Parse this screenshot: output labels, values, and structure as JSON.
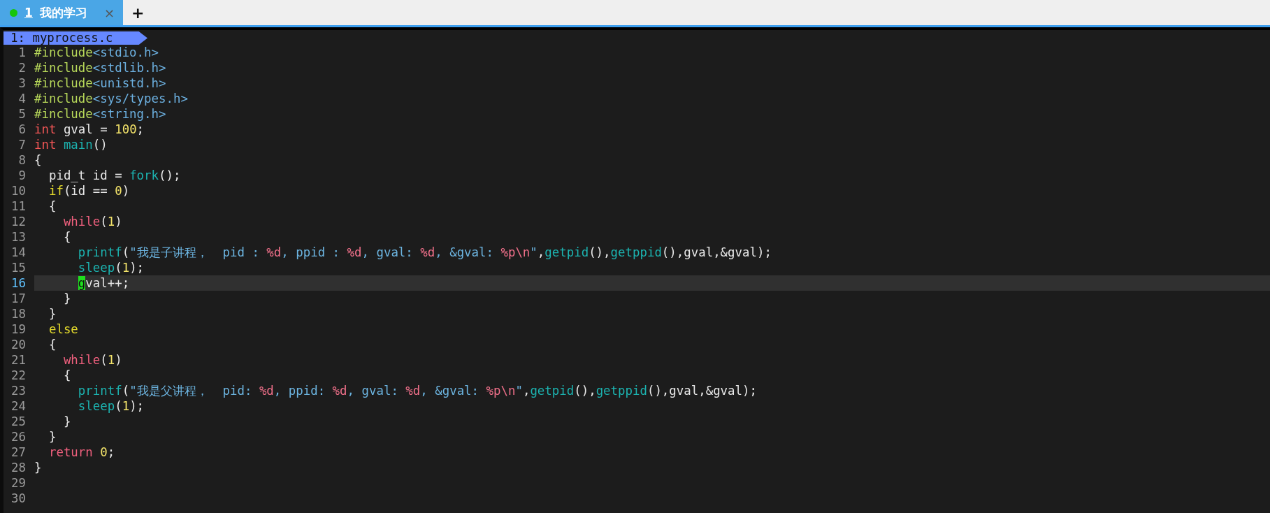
{
  "tabs": [
    {
      "number": "1",
      "title": "我的学习",
      "selected": true,
      "close": "×"
    }
  ],
  "new_tab": "+",
  "buffer_label": "1: myprocess.c",
  "lines": [
    {
      "number": "1",
      "current": false,
      "tokens": [
        {
          "kind": "preproc",
          "text": "#include"
        },
        {
          "kind": "header",
          "text": "<stdio.h>"
        }
      ]
    },
    {
      "number": "2",
      "current": false,
      "tokens": [
        {
          "kind": "preproc",
          "text": "#include"
        },
        {
          "kind": "header",
          "text": "<stdlib.h>"
        }
      ]
    },
    {
      "number": "3",
      "current": false,
      "tokens": [
        {
          "kind": "preproc",
          "text": "#include"
        },
        {
          "kind": "header",
          "text": "<unistd.h>"
        }
      ]
    },
    {
      "number": "4",
      "current": false,
      "tokens": [
        {
          "kind": "preproc",
          "text": "#include"
        },
        {
          "kind": "header",
          "text": "<sys/types.h>"
        }
      ]
    },
    {
      "number": "5",
      "current": false,
      "tokens": [
        {
          "kind": "preproc",
          "text": "#include"
        },
        {
          "kind": "header",
          "text": "<string.h>"
        }
      ]
    },
    {
      "number": "6",
      "current": false,
      "tokens": [
        {
          "kind": "type",
          "text": "int"
        },
        {
          "kind": "plain",
          "text": " gval = "
        },
        {
          "kind": "number",
          "text": "100"
        },
        {
          "kind": "plain",
          "text": ";"
        }
      ]
    },
    {
      "number": "7",
      "current": false,
      "tokens": [
        {
          "kind": "type",
          "text": "int"
        },
        {
          "kind": "func",
          "text": " main"
        },
        {
          "kind": "plain",
          "text": "()"
        }
      ]
    },
    {
      "number": "8",
      "current": false,
      "tokens": [
        {
          "kind": "plain",
          "text": "{"
        }
      ]
    },
    {
      "number": "9",
      "current": false,
      "tokens": [
        {
          "kind": "plain",
          "text": "  pid_t id = "
        },
        {
          "kind": "func",
          "text": "fork"
        },
        {
          "kind": "plain",
          "text": "();"
        }
      ]
    },
    {
      "number": "10",
      "current": false,
      "tokens": [
        {
          "kind": "cond",
          "text": "  if"
        },
        {
          "kind": "plain",
          "text": "(id == "
        },
        {
          "kind": "number",
          "text": "0"
        },
        {
          "kind": "plain",
          "text": ")"
        }
      ]
    },
    {
      "number": "11",
      "current": false,
      "tokens": [
        {
          "kind": "plain",
          "text": "  {"
        }
      ]
    },
    {
      "number": "12",
      "current": false,
      "tokens": [
        {
          "kind": "keyword",
          "text": "    while"
        },
        {
          "kind": "plain",
          "text": "("
        },
        {
          "kind": "number",
          "text": "1"
        },
        {
          "kind": "plain",
          "text": ")"
        }
      ]
    },
    {
      "number": "13",
      "current": false,
      "tokens": [
        {
          "kind": "plain",
          "text": "    {"
        }
      ]
    },
    {
      "number": "14",
      "current": false,
      "tokens": [
        {
          "kind": "func",
          "text": "      printf"
        },
        {
          "kind": "plain",
          "text": "("
        },
        {
          "kind": "string",
          "text": "\"我是子讲程，  pid : "
        },
        {
          "kind": "format",
          "text": "%d"
        },
        {
          "kind": "string",
          "text": ", ppid : "
        },
        {
          "kind": "format",
          "text": "%d"
        },
        {
          "kind": "string",
          "text": ", gval: "
        },
        {
          "kind": "format",
          "text": "%d"
        },
        {
          "kind": "string",
          "text": ", &gval: "
        },
        {
          "kind": "format",
          "text": "%p\\n"
        },
        {
          "kind": "string",
          "text": "\""
        },
        {
          "kind": "plain",
          "text": ","
        },
        {
          "kind": "func",
          "text": "getpid"
        },
        {
          "kind": "plain",
          "text": "(),"
        },
        {
          "kind": "func",
          "text": "getppid"
        },
        {
          "kind": "plain",
          "text": "(),gval,&gval);"
        }
      ]
    },
    {
      "number": "15",
      "current": false,
      "tokens": [
        {
          "kind": "func",
          "text": "      sleep"
        },
        {
          "kind": "plain",
          "text": "("
        },
        {
          "kind": "number",
          "text": "1"
        },
        {
          "kind": "plain",
          "text": ");"
        }
      ]
    },
    {
      "number": "16",
      "current": true,
      "tokens": [
        {
          "kind": "cursor",
          "text": "      g"
        },
        {
          "kind": "plain",
          "text": "val++;"
        }
      ]
    },
    {
      "number": "17",
      "current": false,
      "tokens": [
        {
          "kind": "plain",
          "text": "    }"
        }
      ]
    },
    {
      "number": "18",
      "current": false,
      "tokens": [
        {
          "kind": "plain",
          "text": "  }"
        }
      ]
    },
    {
      "number": "19",
      "current": false,
      "tokens": [
        {
          "kind": "cond",
          "text": "  else"
        }
      ]
    },
    {
      "number": "20",
      "current": false,
      "tokens": [
        {
          "kind": "plain",
          "text": "  {"
        }
      ]
    },
    {
      "number": "21",
      "current": false,
      "tokens": [
        {
          "kind": "keyword",
          "text": "    while"
        },
        {
          "kind": "plain",
          "text": "("
        },
        {
          "kind": "number",
          "text": "1"
        },
        {
          "kind": "plain",
          "text": ")"
        }
      ]
    },
    {
      "number": "22",
      "current": false,
      "tokens": [
        {
          "kind": "plain",
          "text": "    {"
        }
      ]
    },
    {
      "number": "23",
      "current": false,
      "tokens": [
        {
          "kind": "func",
          "text": "      printf"
        },
        {
          "kind": "plain",
          "text": "("
        },
        {
          "kind": "string",
          "text": "\"我是父讲程，  pid: "
        },
        {
          "kind": "format",
          "text": "%d"
        },
        {
          "kind": "string",
          "text": ", ppid: "
        },
        {
          "kind": "format",
          "text": "%d"
        },
        {
          "kind": "string",
          "text": ", gval: "
        },
        {
          "kind": "format",
          "text": "%d"
        },
        {
          "kind": "string",
          "text": ", &gval: "
        },
        {
          "kind": "format",
          "text": "%p\\n"
        },
        {
          "kind": "string",
          "text": "\""
        },
        {
          "kind": "plain",
          "text": ","
        },
        {
          "kind": "func",
          "text": "getpid"
        },
        {
          "kind": "plain",
          "text": "(),"
        },
        {
          "kind": "func",
          "text": "getppid"
        },
        {
          "kind": "plain",
          "text": "(),gval,&gval);"
        }
      ]
    },
    {
      "number": "24",
      "current": false,
      "tokens": [
        {
          "kind": "func",
          "text": "      sleep"
        },
        {
          "kind": "plain",
          "text": "("
        },
        {
          "kind": "number",
          "text": "1"
        },
        {
          "kind": "plain",
          "text": ");"
        }
      ]
    },
    {
      "number": "25",
      "current": false,
      "tokens": [
        {
          "kind": "plain",
          "text": "    }"
        }
      ]
    },
    {
      "number": "26",
      "current": false,
      "tokens": [
        {
          "kind": "plain",
          "text": "  }"
        }
      ]
    },
    {
      "number": "27",
      "current": false,
      "tokens": [
        {
          "kind": "keyword",
          "text": "  return"
        },
        {
          "kind": "number",
          "text": " 0"
        },
        {
          "kind": "plain",
          "text": ";"
        }
      ]
    },
    {
      "number": "28",
      "current": false,
      "tokens": [
        {
          "kind": "plain",
          "text": "}"
        }
      ]
    },
    {
      "number": "29",
      "current": false
    },
    {
      "number": "30",
      "current": false
    }
  ]
}
